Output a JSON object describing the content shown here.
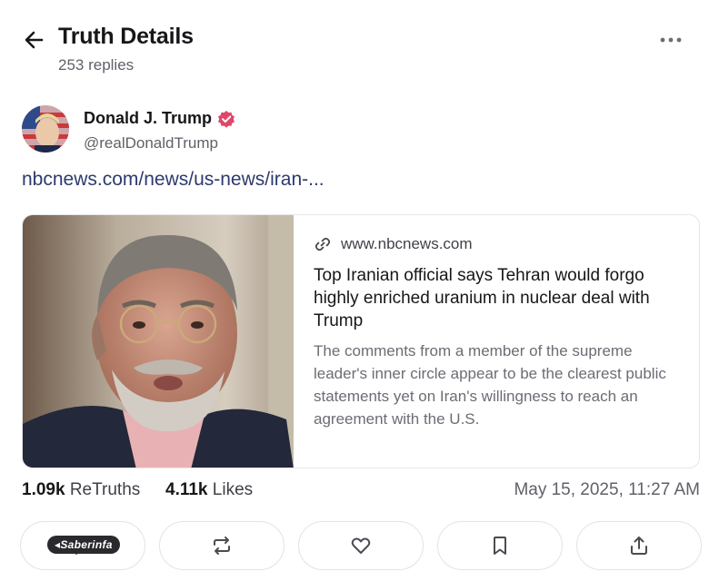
{
  "header": {
    "title": "Truth Details",
    "replies": "253 replies"
  },
  "author": {
    "name": "Donald J. Trump",
    "handle": "@realDonaldTrump"
  },
  "post": {
    "link_text": "nbcnews.com/news/us-news/iran-..."
  },
  "link_card": {
    "domain": "www.nbcnews.com",
    "title": "Top Iranian official says Tehran would forgo highly enriched uranium in nuclear deal with Trump",
    "description": "The comments from a member of the supreme leader's inner circle appear to be the clearest public statements yet on Iran's willingness to reach an agreement with the U.S."
  },
  "stats": {
    "retruths_count": "1.09k",
    "retruths_label": "ReTruths",
    "likes_count": "4.11k",
    "likes_label": "Likes",
    "date": "May 15, 2025, 11:27 AM"
  },
  "actions": [
    "reply-icon",
    "retruth-icon",
    "heart-icon",
    "bookmark-icon",
    "share-icon"
  ],
  "watermark": "Saberinfa",
  "colors": {
    "verified": "#e0486a",
    "link": "#2e3a6e",
    "muted": "#5f6168"
  }
}
